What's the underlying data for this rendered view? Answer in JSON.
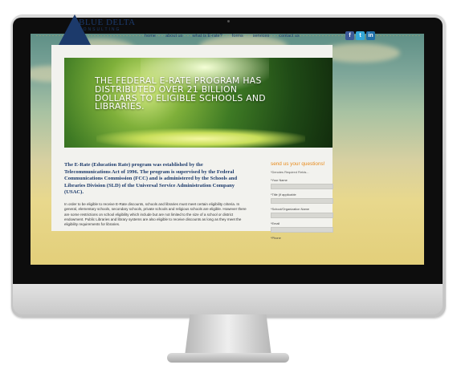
{
  "site": {
    "logo_text": "BLUE DELTA",
    "logo_sub": "CONSULTING"
  },
  "nav": {
    "items": [
      "home",
      "about us",
      "what is E-rate?",
      "forms",
      "services",
      "contact us"
    ]
  },
  "social": {
    "facebook": "f",
    "twitter": "t",
    "linkedin": "in"
  },
  "hero": {
    "text": "The Federal E-Rate Program has distributed over 21 billion dollars to eligible schools and libraries."
  },
  "intro": {
    "bold": "The E-Rate (Education Rate) program was established by the Telecommunications Act of 1996. The program is supervised by the Federal Communications Commission (FCC) and is administered by the Schools and Libraries Division (SLD) of the Universal Service Administration Company (USAC).",
    "body": "In order to be eligible to receive E-Rate discounts, schools and libraries must meet certain eligibility criteria. In general, elementary schools, secondary schools, private schools and religious schools are eligible. However there are some restrictions on school eligibility which include but are not limited to the size of a school or district endowment. Public Libraries and library systems are also eligible to receive discounts as long as they meet the eligibility requirements for libraries."
  },
  "form": {
    "title": "send us your questions!",
    "note": "*Denotes Required Fields...",
    "fields": [
      "*Your Name",
      "*Title (if applicable",
      "*School/Organization Name",
      "*Email",
      "*Phone"
    ]
  },
  "colors": {
    "brand": "#1c3a6b",
    "accent": "#e88a1a"
  }
}
